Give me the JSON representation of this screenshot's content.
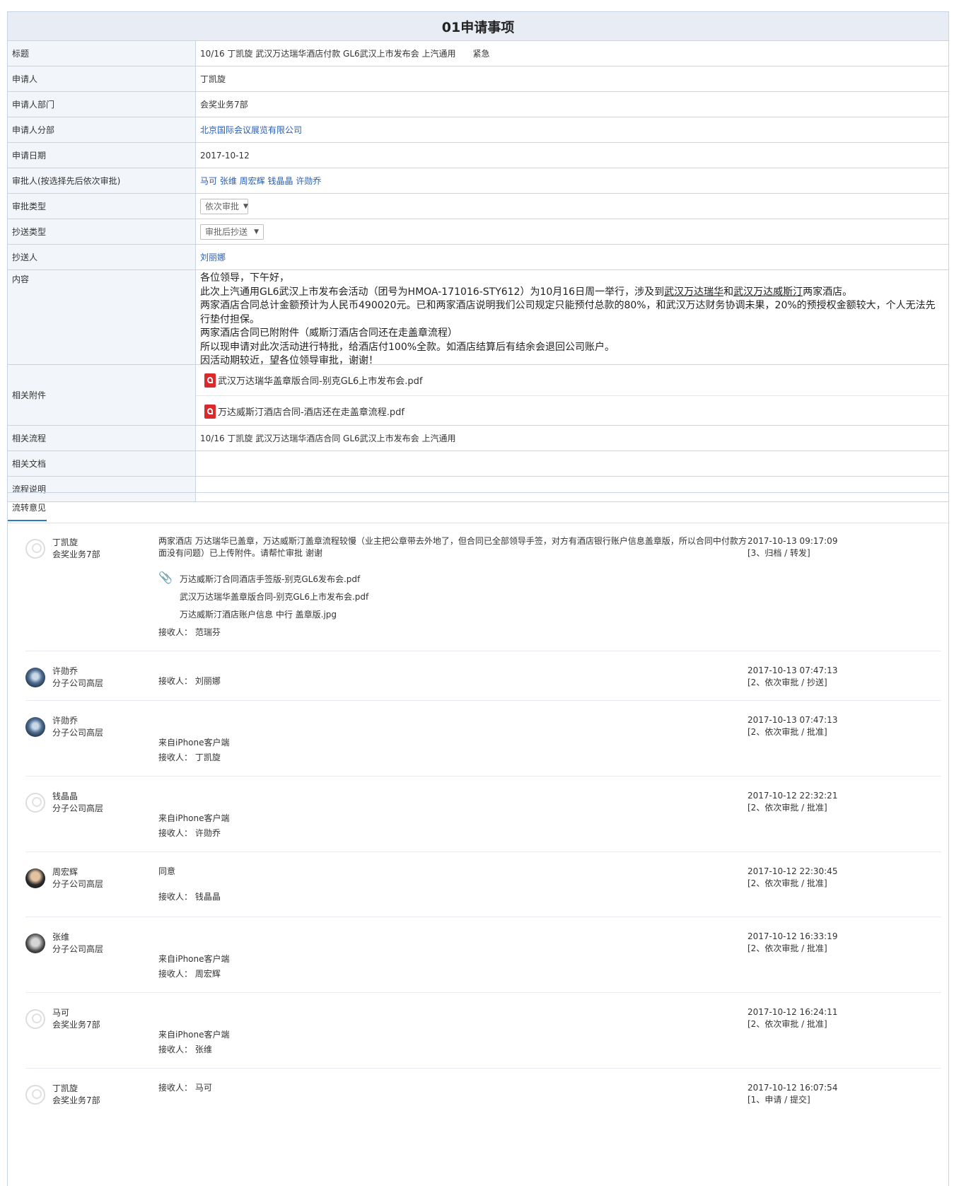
{
  "form": {
    "title": "01申请事项",
    "rows": [
      {
        "label": "标题",
        "value": "10/16 丁凯旋 武汉万达瑞华酒店付款 GL6武汉上市发布会 上汽通用",
        "extra": "紧急"
      },
      {
        "label": "申请人",
        "value": "丁凯旋"
      },
      {
        "label": "申请人部门",
        "value": "会奖业务7部"
      },
      {
        "label": "申请人分部",
        "value": "北京国际会议展览有限公司"
      },
      {
        "label": "申请日期",
        "value": "2017-10-12"
      },
      {
        "label": "审批人(按选择先后依次审批)",
        "value": "马可 张维 周宏辉 钱晶晶 许勋乔"
      },
      {
        "label": "审批类型",
        "value": "依次审批"
      },
      {
        "label": "抄送类型",
        "value": "审批后抄送"
      },
      {
        "label": "抄送人",
        "value": "刘丽娜"
      },
      {
        "label": "内容"
      },
      {
        "label": "相关附件"
      },
      {
        "label": "相关流程",
        "value": "10/16 丁凯旋 武汉万达瑞华酒店合同 GL6武汉上市发布会 上汽通用"
      },
      {
        "label": "相关文档",
        "value": ""
      },
      {
        "label": "流程说明",
        "value": ""
      }
    ],
    "content": {
      "l1": "各位领导，下午好，",
      "l2a": "此次上汽通用GL6武汉上市发布会活动（团号为HMOA-171016-STY612）为10月16日周一举行，涉及到",
      "l2b": "武汉万达瑞华",
      "l2c": "和",
      "l2d": "武汉万达威斯汀",
      "l2e": "两家酒店。",
      "l3": "两家酒店合同总计金额预计为人民币490020元。已和两家酒店说明我们公司规定只能预付总款的80%，和武汉万达财务协调未果，20%的预授权金额较大，个人无法先行垫付担保。",
      "l4": "两家酒店合同已附附件（威斯汀酒店合同还在走盖章流程）",
      "l5": "所以现申请对此次活动进行特批，给酒店付100%全款。如酒店结算后有结余会退回公司账户。",
      "l6": "因活动期较近，望各位领导审批，谢谢！"
    },
    "attachments": [
      "武汉万达瑞华盖章版合同-别克GL6上市发布会.pdf",
      "万达威斯汀酒店合同-酒店还在走盖章流程.pdf"
    ]
  },
  "opinions": {
    "tab": "流转意见",
    "receiver_label": "接收人：",
    "entries": [
      {
        "name": "丁凯旋",
        "dept": "会奖业务7部",
        "avatar": "default-avatar-icon",
        "text1": "两家酒店 万达瑞华已盖章，万达威斯汀盖章流程较慢（业主把公章带去外地了，但合同已全部领导手签，对方有酒店银行账户信息盖章版，所以合同中付款方",
        "text2": "面没有问题）已上传附件。请帮忙审批 谢谢",
        "files": [
          "万达威斯汀合同酒店手签版-别克GL6发布会.pdf",
          "武汉万达瑞华盖章版合同-别克GL6上市发布会.pdf",
          "万达威斯汀酒店账户信息 中行 盖章版.jpg"
        ],
        "receiver": "范瑞芬",
        "date": "2017-10-13    09:17:09",
        "action": "[3、归档 / 转发]"
      },
      {
        "name": "许勋乔",
        "dept": "分子公司高层",
        "avatar": "user-photo-icon",
        "receiver": "刘丽娜",
        "date": "2017-10-13    07:47:13",
        "action": "[2、依次审批 / 抄送]"
      },
      {
        "name": "许勋乔",
        "dept": "分子公司高层",
        "avatar": "user-photo-icon",
        "source": "来自iPhone客户端",
        "receiver": "丁凯旋",
        "date": "2017-10-13    07:47:13",
        "action": "[2、依次审批 / 批准]"
      },
      {
        "name": "钱晶晶",
        "dept": "分子公司高层",
        "avatar": "default-avatar-icon",
        "source": "来自iPhone客户端",
        "receiver": "许勋乔",
        "date": "2017-10-12    22:32:21",
        "action": "[2、依次审批 / 批准]"
      },
      {
        "name": "周宏辉",
        "dept": "分子公司高层",
        "avatar": "user-photo-icon",
        "text1": "同意",
        "receiver": "钱晶晶",
        "date": "2017-10-12    22:30:45",
        "action": "[2、依次审批 / 批准]"
      },
      {
        "name": "张维",
        "dept": "分子公司高层",
        "avatar": "user-photo-icon",
        "source": "来自iPhone客户端",
        "receiver": "周宏辉",
        "date": "2017-10-12    16:33:19",
        "action": "[2、依次审批 / 批准]"
      },
      {
        "name": "马可",
        "dept": "会奖业务7部",
        "avatar": "default-avatar-icon",
        "source": "来自iPhone客户端",
        "receiver": "张维",
        "date": "2017-10-12    16:24:11",
        "action": "[2、依次审批 / 批准]"
      },
      {
        "name": "丁凯旋",
        "dept": "会奖业务7部",
        "avatar": "default-avatar-icon",
        "receiver": "马可",
        "date": "2017-10-12    16:07:54",
        "action": "[1、申请 / 提交]"
      }
    ]
  }
}
